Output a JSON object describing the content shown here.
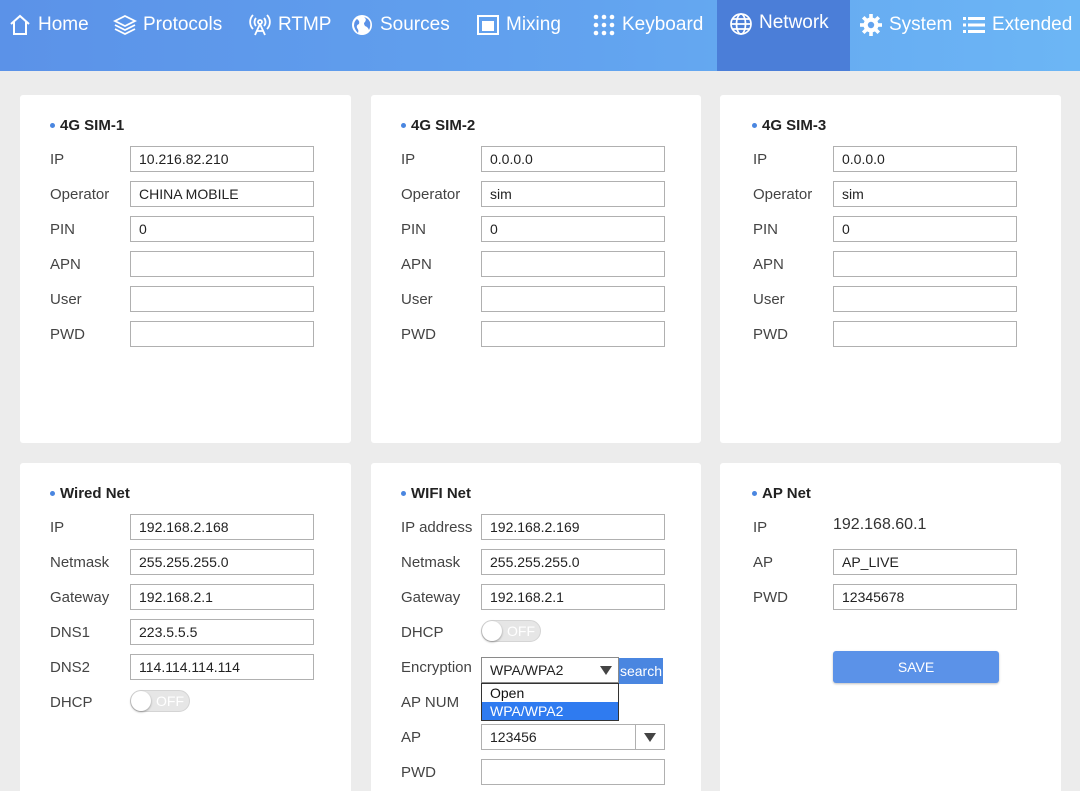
{
  "nav": {
    "items": [
      {
        "label": "Home",
        "icon": "home-icon"
      },
      {
        "label": "Protocols",
        "icon": "layers-icon"
      },
      {
        "label": "RTMP",
        "icon": "broadcast-icon"
      },
      {
        "label": "Sources",
        "icon": "globe-icon"
      },
      {
        "label": "Mixing",
        "icon": "window-icon"
      },
      {
        "label": "Keyboard",
        "icon": "keypad-icon"
      },
      {
        "label": "Network",
        "icon": "network-globe-icon"
      },
      {
        "label": "System",
        "icon": "gear-icon"
      },
      {
        "label": "Extended",
        "icon": "list-icon"
      }
    ],
    "active": "Network"
  },
  "sim1": {
    "title": "4G SIM-1",
    "labels": {
      "ip": "IP",
      "operator": "Operator",
      "pin": "PIN",
      "apn": "APN",
      "user": "User",
      "pwd": "PWD"
    },
    "values": {
      "ip": "10.216.82.210",
      "operator": "CHINA MOBILE",
      "pin": "0",
      "apn": "",
      "user": "",
      "pwd": ""
    }
  },
  "sim2": {
    "title": "4G SIM-2",
    "labels": {
      "ip": "IP",
      "operator": "Operator",
      "pin": "PIN",
      "apn": "APN",
      "user": "User",
      "pwd": "PWD"
    },
    "values": {
      "ip": "0.0.0.0",
      "operator": "sim",
      "pin": "0",
      "apn": "",
      "user": "",
      "pwd": ""
    }
  },
  "sim3": {
    "title": "4G SIM-3",
    "labels": {
      "ip": "IP",
      "operator": "Operator",
      "pin": "PIN",
      "apn": "APN",
      "user": "User",
      "pwd": "PWD"
    },
    "values": {
      "ip": "0.0.0.0",
      "operator": "sim",
      "pin": "0",
      "apn": "",
      "user": "",
      "pwd": ""
    }
  },
  "wired": {
    "title": "Wired Net",
    "labels": {
      "ip": "IP",
      "netmask": "Netmask",
      "gateway": "Gateway",
      "dns1": "DNS1",
      "dns2": "DNS2",
      "dhcp": "DHCP"
    },
    "values": {
      "ip": "192.168.2.168",
      "netmask": "255.255.255.0",
      "gateway": "192.168.2.1",
      "dns1": "223.5.5.5",
      "dns2": "114.114.114.114"
    },
    "dhcp_state": "OFF"
  },
  "wifi": {
    "title": "WIFI Net",
    "labels": {
      "ip": "IP address",
      "netmask": "Netmask",
      "gateway": "Gateway",
      "dhcp": "DHCP",
      "encryption": "Encryption",
      "ap_num": "AP NUM",
      "ap": "AP",
      "pwd": "PWD"
    },
    "values": {
      "ip": "192.168.2.169",
      "netmask": "255.255.255.0",
      "gateway": "192.168.2.1",
      "encryption": "WPA/WPA2",
      "ap": "123456",
      "pwd": ""
    },
    "dhcp_state": "OFF",
    "search_label": "search",
    "encryption_options": [
      "Open",
      "WPA/WPA2"
    ]
  },
  "apnet": {
    "title": "AP Net",
    "labels": {
      "ip": "IP",
      "ap": "AP",
      "pwd": "PWD"
    },
    "values": {
      "ip": "192.168.60.1",
      "ap": "AP_LIVE",
      "pwd": "12345678"
    },
    "save_label": "SAVE"
  },
  "colors": {
    "nav_bg": "#5b92e8",
    "nav_active": "#4b7ed8",
    "accent": "#4a86e0",
    "page_bg": "#ececec"
  }
}
